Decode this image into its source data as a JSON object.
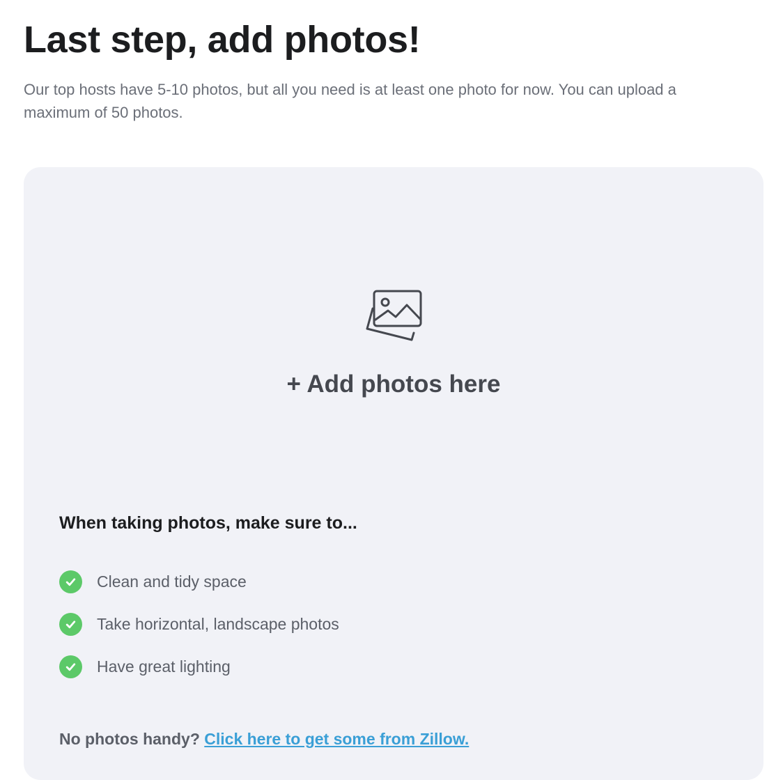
{
  "header": {
    "title": "Last step, add photos!",
    "subtitle": "Our top hosts have 5-10 photos, but all you need is at least one photo for now. You can upload a maximum of 50 photos."
  },
  "dropzone": {
    "icon": "photos-icon",
    "label": "+ Add photos here"
  },
  "tips": {
    "heading": "When taking photos, make sure to...",
    "items": [
      {
        "icon": "check-circle-icon",
        "label": "Clean and tidy space"
      },
      {
        "icon": "check-circle-icon",
        "label": "Take horizontal, landscape photos"
      },
      {
        "icon": "check-circle-icon",
        "label": "Have great lighting"
      }
    ]
  },
  "footer": {
    "prompt": "No photos handy?",
    "link_label": "Click here to get some from Zillow."
  },
  "colors": {
    "panel_background": "#f1f2f7",
    "check_green": "#5cc968",
    "link_blue": "#3a9fd6",
    "heading_text": "#1c1d1f",
    "body_text": "#6b6f78"
  }
}
